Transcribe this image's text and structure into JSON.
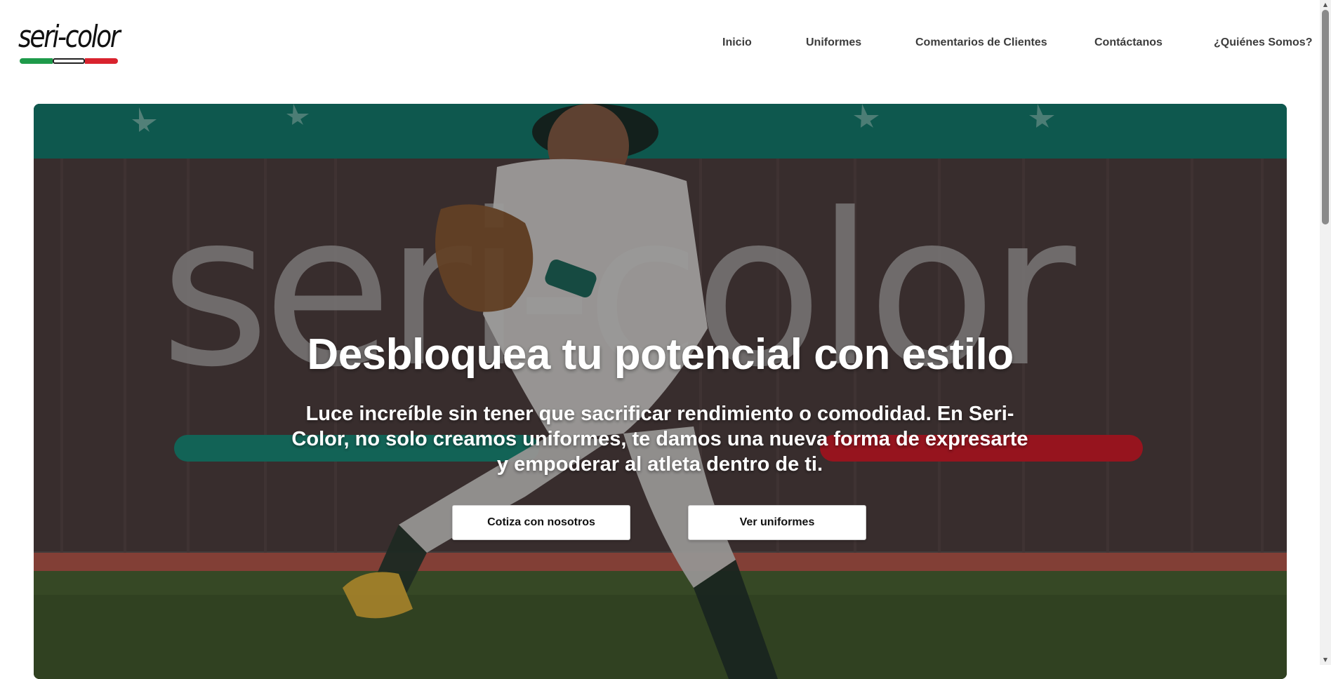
{
  "logo": {
    "text": "seri-color",
    "colors": [
      "#1e9a4a",
      "#ffffff",
      "#d9232e"
    ]
  },
  "nav": {
    "items": [
      {
        "label": "Inicio"
      },
      {
        "label": "Uniformes"
      },
      {
        "label": "Comentarios de Clientes"
      },
      {
        "label": "Contáctanos"
      },
      {
        "label": "¿Quiénes Somos?"
      }
    ]
  },
  "hero": {
    "title": "Desbloquea tu potencial con estilo",
    "subtitle": "Luce increíble sin tener que sacrificar rendimiento o comodidad. En Seri-Color, no solo creamos uniformes, te damos una nueva forma de expresarte y empoderar al atleta dentro de ti.",
    "primary_button": "Cotiza con nosotros",
    "secondary_button": "Ver uniformes",
    "background_wall_text": "seri-color"
  },
  "colors": {
    "accent_green": "#137a6a",
    "accent_red": "#d01c2a",
    "field_green": "#4b6434"
  }
}
